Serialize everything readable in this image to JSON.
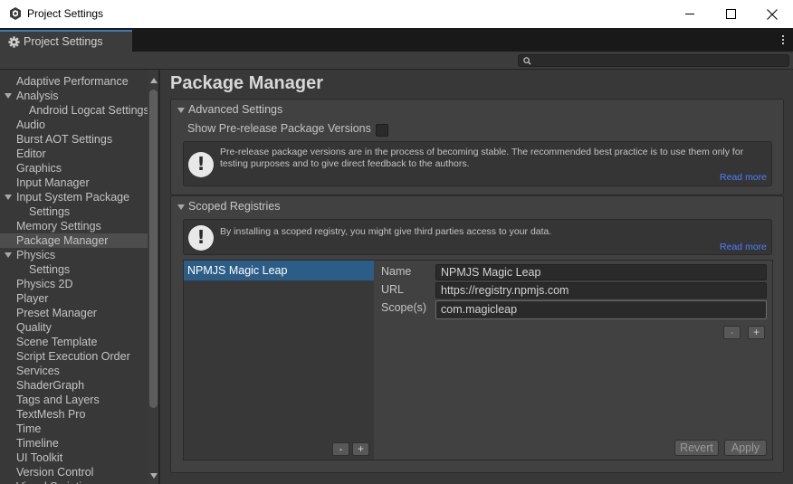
{
  "window": {
    "title": "Project Settings",
    "controls": {
      "minimize": "minimize-icon",
      "maximize": "maximize-icon",
      "close": "close-icon"
    }
  },
  "tab": {
    "label": "Project Settings",
    "icon": "gear-icon"
  },
  "search": {
    "placeholder": "",
    "icon": "search-icon"
  },
  "sidebar": {
    "items": [
      {
        "label": "Adaptive Performance",
        "indent": 0,
        "expandable": false,
        "selected": false
      },
      {
        "label": "Analysis",
        "indent": 0,
        "expandable": true,
        "selected": false
      },
      {
        "label": "Android Logcat Settings",
        "indent": 1,
        "expandable": false,
        "selected": false
      },
      {
        "label": "Audio",
        "indent": 0,
        "expandable": false,
        "selected": false
      },
      {
        "label": "Burst AOT Settings",
        "indent": 0,
        "expandable": false,
        "selected": false
      },
      {
        "label": "Editor",
        "indent": 0,
        "expandable": false,
        "selected": false
      },
      {
        "label": "Graphics",
        "indent": 0,
        "expandable": false,
        "selected": false
      },
      {
        "label": "Input Manager",
        "indent": 0,
        "expandable": false,
        "selected": false
      },
      {
        "label": "Input System Package",
        "indent": 0,
        "expandable": true,
        "selected": false
      },
      {
        "label": "Settings",
        "indent": 1,
        "expandable": false,
        "selected": false
      },
      {
        "label": "Memory Settings",
        "indent": 0,
        "expandable": false,
        "selected": false
      },
      {
        "label": "Package Manager",
        "indent": 0,
        "expandable": false,
        "selected": true
      },
      {
        "label": "Physics",
        "indent": 0,
        "expandable": true,
        "selected": false
      },
      {
        "label": "Settings",
        "indent": 1,
        "expandable": false,
        "selected": false
      },
      {
        "label": "Physics 2D",
        "indent": 0,
        "expandable": false,
        "selected": false
      },
      {
        "label": "Player",
        "indent": 0,
        "expandable": false,
        "selected": false
      },
      {
        "label": "Preset Manager",
        "indent": 0,
        "expandable": false,
        "selected": false
      },
      {
        "label": "Quality",
        "indent": 0,
        "expandable": false,
        "selected": false
      },
      {
        "label": "Scene Template",
        "indent": 0,
        "expandable": false,
        "selected": false
      },
      {
        "label": "Script Execution Order",
        "indent": 0,
        "expandable": false,
        "selected": false
      },
      {
        "label": "Services",
        "indent": 0,
        "expandable": false,
        "selected": false
      },
      {
        "label": "ShaderGraph",
        "indent": 0,
        "expandable": false,
        "selected": false
      },
      {
        "label": "Tags and Layers",
        "indent": 0,
        "expandable": false,
        "selected": false
      },
      {
        "label": "TextMesh Pro",
        "indent": 0,
        "expandable": false,
        "selected": false
      },
      {
        "label": "Time",
        "indent": 0,
        "expandable": false,
        "selected": false
      },
      {
        "label": "Timeline",
        "indent": 0,
        "expandable": false,
        "selected": false
      },
      {
        "label": "UI Toolkit",
        "indent": 0,
        "expandable": false,
        "selected": false
      },
      {
        "label": "Version Control",
        "indent": 0,
        "expandable": false,
        "selected": false
      },
      {
        "label": "Visual Scripting",
        "indent": 0,
        "expandable": false,
        "selected": false
      }
    ]
  },
  "main": {
    "title": "Package Manager",
    "advanced": {
      "header": "Advanced Settings",
      "toggle_label": "Show Pre-release Package Versions",
      "toggle_checked": false,
      "help_line1": "Pre-release package versions are in the process of becoming stable. The recommended best practice is to use them only for",
      "help_line2": "testing purposes and to give direct feedback to the authors.",
      "read_more": "Read more"
    },
    "scoped": {
      "header": "Scoped Registries",
      "help_text": "By installing a scoped registry, you might give third parties access to your data.",
      "read_more": "Read more",
      "registries": [
        "NPMJS Magic Leap"
      ],
      "name_label": "Name",
      "name_value": "NPMJS Magic Leap",
      "url_label": "URL",
      "url_value": "https://registry.npmjs.com",
      "scopes_label": "Scope(s)",
      "scope_value": "com.magicleap",
      "remove_scope": "-",
      "add_scope": "+",
      "remove_registry": "-",
      "add_registry": "+",
      "revert_label": "Revert",
      "apply_label": "Apply"
    }
  },
  "colors": {
    "accent": "#3a79bb",
    "selection": "#2c5d87",
    "link": "#4c7eff",
    "panel": "#383838"
  }
}
